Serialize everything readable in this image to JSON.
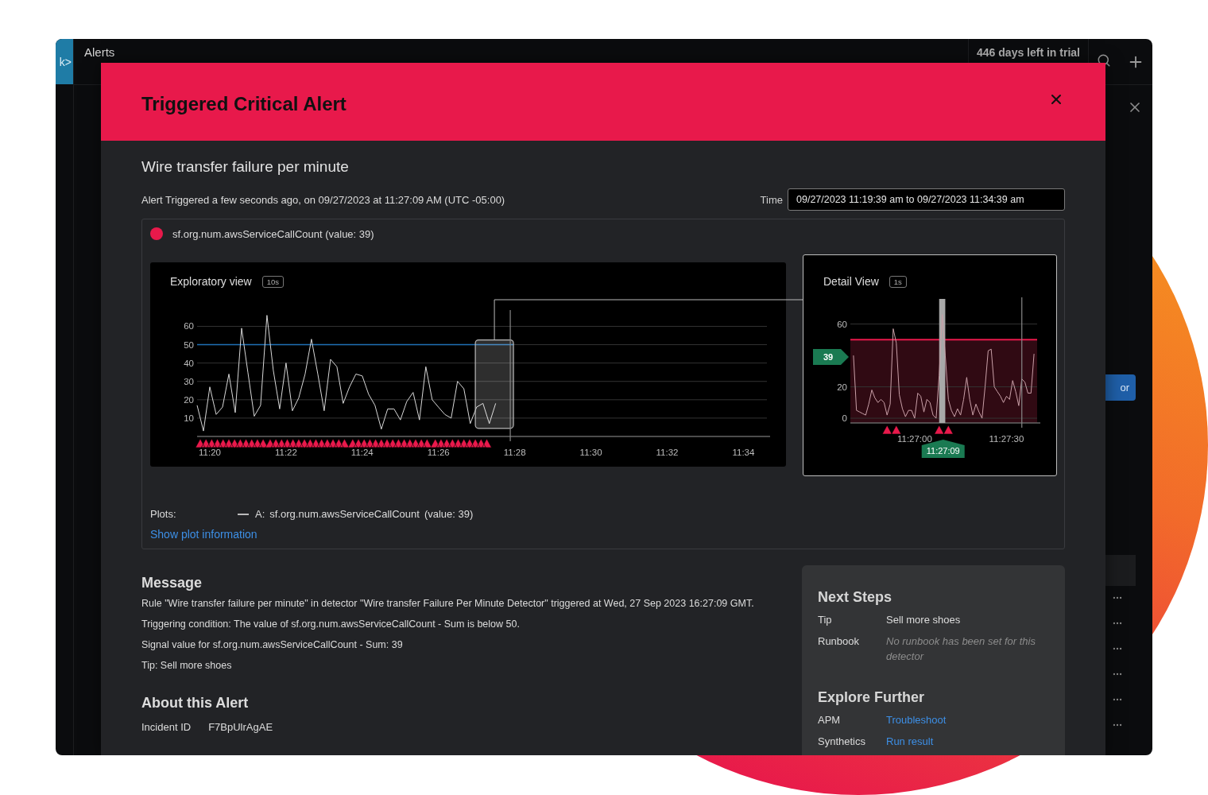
{
  "app": {
    "logo": "k>",
    "page_title": "Alerts",
    "trial_notice": "446 days left in trial",
    "side_button": "or"
  },
  "modal": {
    "title": "Triggered Critical Alert",
    "detector_name": "Wire transfer failure per minute",
    "triggered_text": "Alert Triggered a few seconds ago, on 09/27/2023 at 11:27:09 AM (UTC -05:00)",
    "time_label": "Time",
    "time_value": "09/27/2023 11:19:39 am to 09/27/2023 11:34:39 am"
  },
  "signal": {
    "label": "sf.org.num.awsServiceCallCount (value: 39)"
  },
  "exploratory": {
    "title": "Exploratory view",
    "resolution": "10s",
    "chart_data": {
      "type": "line",
      "categories": [
        null,
        null,
        "11:20",
        null,
        null,
        null,
        null,
        null,
        null,
        null,
        null,
        null,
        null,
        null,
        "11:22",
        null,
        null,
        null,
        null,
        null,
        null,
        null,
        null,
        null,
        null,
        null,
        "11:24",
        null,
        null,
        null,
        null,
        null,
        null,
        null,
        null,
        null,
        null,
        null,
        "11:26",
        null,
        null,
        null,
        null,
        null,
        null,
        null,
        null,
        null,
        null,
        null,
        "11:28",
        null,
        null,
        null,
        null,
        null,
        null,
        null,
        null,
        null,
        null,
        null,
        "11:30",
        null,
        null,
        null,
        null,
        null,
        null,
        null,
        null,
        null,
        null,
        null,
        "11:32",
        null,
        null,
        null,
        null,
        null,
        null,
        null,
        null,
        null,
        null,
        null,
        "11:34",
        null,
        null,
        null
      ],
      "series": [
        {
          "color": "#d8d8d8",
          "values": [
            17,
            3,
            27,
            12,
            16,
            34,
            13,
            59,
            35,
            11,
            17,
            66,
            36,
            15,
            40,
            14,
            21,
            34,
            53,
            34,
            14,
            42,
            38,
            18,
            27,
            34,
            33,
            23,
            17,
            4,
            15,
            15,
            9,
            19,
            24,
            9,
            38,
            20,
            16,
            12,
            10,
            30,
            26,
            7,
            16,
            18,
            7,
            18,
            null,
            null,
            null,
            null,
            null,
            null,
            null,
            null,
            null,
            null,
            null,
            null,
            null,
            null,
            null,
            null,
            null,
            null,
            null,
            null,
            null,
            null,
            null,
            null,
            null,
            null,
            null,
            null,
            null,
            null,
            null,
            null,
            null,
            null,
            null,
            null,
            null,
            null,
            null,
            null,
            null,
            null
          ]
        }
      ],
      "ylim": [
        0,
        68
      ],
      "yticks": [
        10,
        20,
        30,
        40,
        50,
        60
      ],
      "grid": true,
      "ref_lines": [
        {
          "axis": "y",
          "value": 50
        }
      ]
    }
  },
  "detail": {
    "title": "Detail View",
    "resolution": "1s",
    "value_flag": "39",
    "time_flag": "11:27:09",
    "chart_data": {
      "type": "line",
      "categories": [
        null,
        null,
        null,
        null,
        null,
        null,
        null,
        null,
        null,
        null,
        null,
        null,
        null,
        null,
        null,
        null,
        null,
        null,
        null,
        null,
        "11:27:00",
        null,
        null,
        null,
        null,
        null,
        null,
        null,
        null,
        null,
        null,
        null,
        null,
        null,
        null,
        null,
        null,
        null,
        null,
        null,
        null,
        null,
        null,
        null,
        null,
        null,
        null,
        null,
        null,
        null,
        "11:27:30",
        null,
        null,
        null,
        null,
        null,
        null,
        null,
        null,
        null
      ],
      "series": [
        {
          "color": "#c9a0a8",
          "values": [
            40,
            5,
            4,
            3,
            2,
            9,
            18,
            13,
            10,
            12,
            10,
            2,
            9,
            57,
            48,
            15,
            6,
            1,
            5,
            5,
            0,
            16,
            14,
            4,
            12,
            10,
            2,
            0,
            27,
            66,
            40,
            12,
            5,
            1,
            6,
            2,
            12,
            26,
            12,
            2,
            9,
            4,
            0,
            20,
            43,
            44,
            20,
            17,
            14,
            10,
            14,
            12,
            24,
            17,
            8,
            25,
            23,
            16,
            16,
            41
          ]
        }
      ],
      "ylim": [
        -3,
        76
      ],
      "yticks": [
        0,
        20,
        60
      ],
      "grid": true,
      "ref_lines": [
        {
          "axis": "y",
          "value": 50
        }
      ]
    }
  },
  "plots": {
    "label": "Plots:",
    "items": [
      {
        "name": "A:",
        "metric": "sf.org.num.awsServiceCallCount",
        "value": "(value: 39)"
      }
    ],
    "link": "Show plot information"
  },
  "message": {
    "heading": "Message",
    "lines": [
      "Rule \"Wire transfer failure per minute\" in detector \"Wire transfer Failure Per Minute Detector\" triggered at Wed, 27 Sep 2023 16:27:09 GMT.",
      "Triggering condition: The value of sf.org.num.awsServiceCallCount - Sum is below 50.",
      "Signal value for sf.org.num.awsServiceCallCount - Sum: 39",
      "Tip: Sell more shoes"
    ]
  },
  "about": {
    "heading": "About this Alert",
    "rows": [
      {
        "label": "Incident ID",
        "value": "F7BpUlrAgAE"
      }
    ]
  },
  "next_steps": {
    "heading": "Next Steps",
    "rows": [
      {
        "label": "Tip",
        "value": "Sell more shoes",
        "kind": "text"
      },
      {
        "label": "Runbook",
        "value": "No runbook has been set for this detector",
        "kind": "empty"
      }
    ]
  },
  "explore_further": {
    "heading": "Explore Further",
    "rows": [
      {
        "label": "APM",
        "value": "Troubleshoot",
        "kind": "link"
      },
      {
        "label": "Synthetics",
        "value": "Run result",
        "kind": "link"
      }
    ]
  }
}
